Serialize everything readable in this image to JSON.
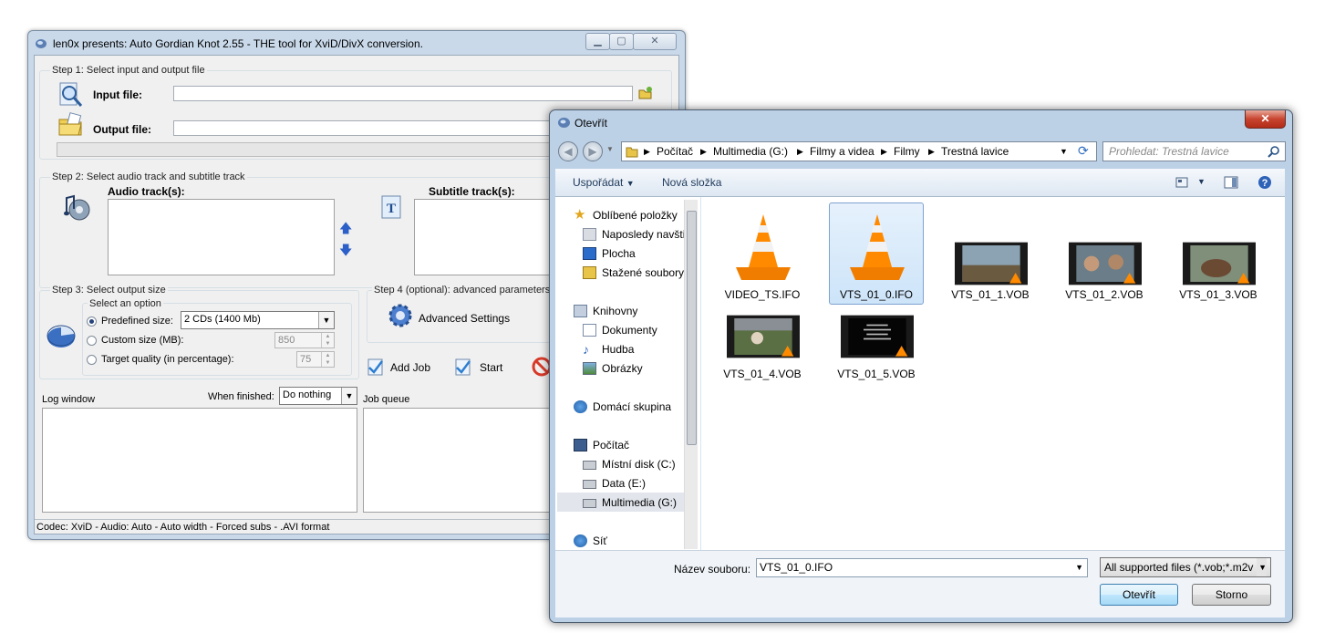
{
  "agk": {
    "title": "len0x presents: Auto Gordian Knot 2.55 - THE tool for XviD/DivX conversion.",
    "step1": {
      "label": "Step 1: Select input and output file",
      "input_label": "Input file:",
      "input_value": "",
      "output_label": "Output file:",
      "output_value": ""
    },
    "step2": {
      "label": "Step 2: Select audio track and subtitle track",
      "audio_label": "Audio track(s):",
      "subtitle_label": "Subtitle track(s):"
    },
    "step3": {
      "label": "Step 3: Select output size",
      "option_group": "Select an option",
      "predefined_label": "Predefined size:",
      "predefined_value": "2 CDs (1400 Mb)",
      "custom_label": "Custom size (MB):",
      "custom_value": "850",
      "quality_label": "Target quality (in percentage):",
      "quality_value": "75"
    },
    "step4": {
      "label": "Step 4 (optional): advanced parameters",
      "advanced_label": "Advanced Settings"
    },
    "add_job_label": "Add Job",
    "start_label": "Start",
    "log_label": "Log window",
    "when_finished_label": "When finished:",
    "when_finished_value": "Do nothing",
    "job_queue_label": "Job queue",
    "status": "Codec: XviD -  Audio: Auto -  Auto width - Forced subs - .AVI format"
  },
  "dialog": {
    "title": "Otevřít",
    "breadcrumb": [
      "Počítač",
      "Multimedia (G:)",
      "Filmy a videa",
      "Filmy",
      "Trestná lavice"
    ],
    "search_placeholder": "Prohledat: Trestná lavice",
    "toolbar": {
      "organize_label": "Uspořádat",
      "new_folder_label": "Nová složka"
    },
    "nav": {
      "favorites": "Oblíbené položky",
      "recent": "Naposledy navšti",
      "desktop": "Plocha",
      "downloads": "Stažené soubory",
      "libraries": "Knihovny",
      "documents": "Dokumenty",
      "music": "Hudba",
      "pictures": "Obrázky",
      "homegroup": "Domácí skupina",
      "computer": "Počítač",
      "drive_c": "Místní disk (C:)",
      "drive_e": "Data  (E:)",
      "drive_g": "Multimedia (G:)",
      "network": "Síť"
    },
    "files": [
      {
        "name": "VIDEO_TS.IFO"
      },
      {
        "name": "VTS_01_0.IFO"
      },
      {
        "name": "VTS_01_1.VOB"
      },
      {
        "name": "VTS_01_2.VOB"
      },
      {
        "name": "VTS_01_3.VOB"
      },
      {
        "name": "VTS_01_4.VOB"
      },
      {
        "name": "VTS_01_5.VOB"
      }
    ],
    "filename_label": "Název souboru:",
    "filename_value": "VTS_01_0.IFO",
    "filetype_value": "All supported files (*.vob;*.m2v",
    "open_label": "Otevřít",
    "cancel_label": "Storno"
  }
}
